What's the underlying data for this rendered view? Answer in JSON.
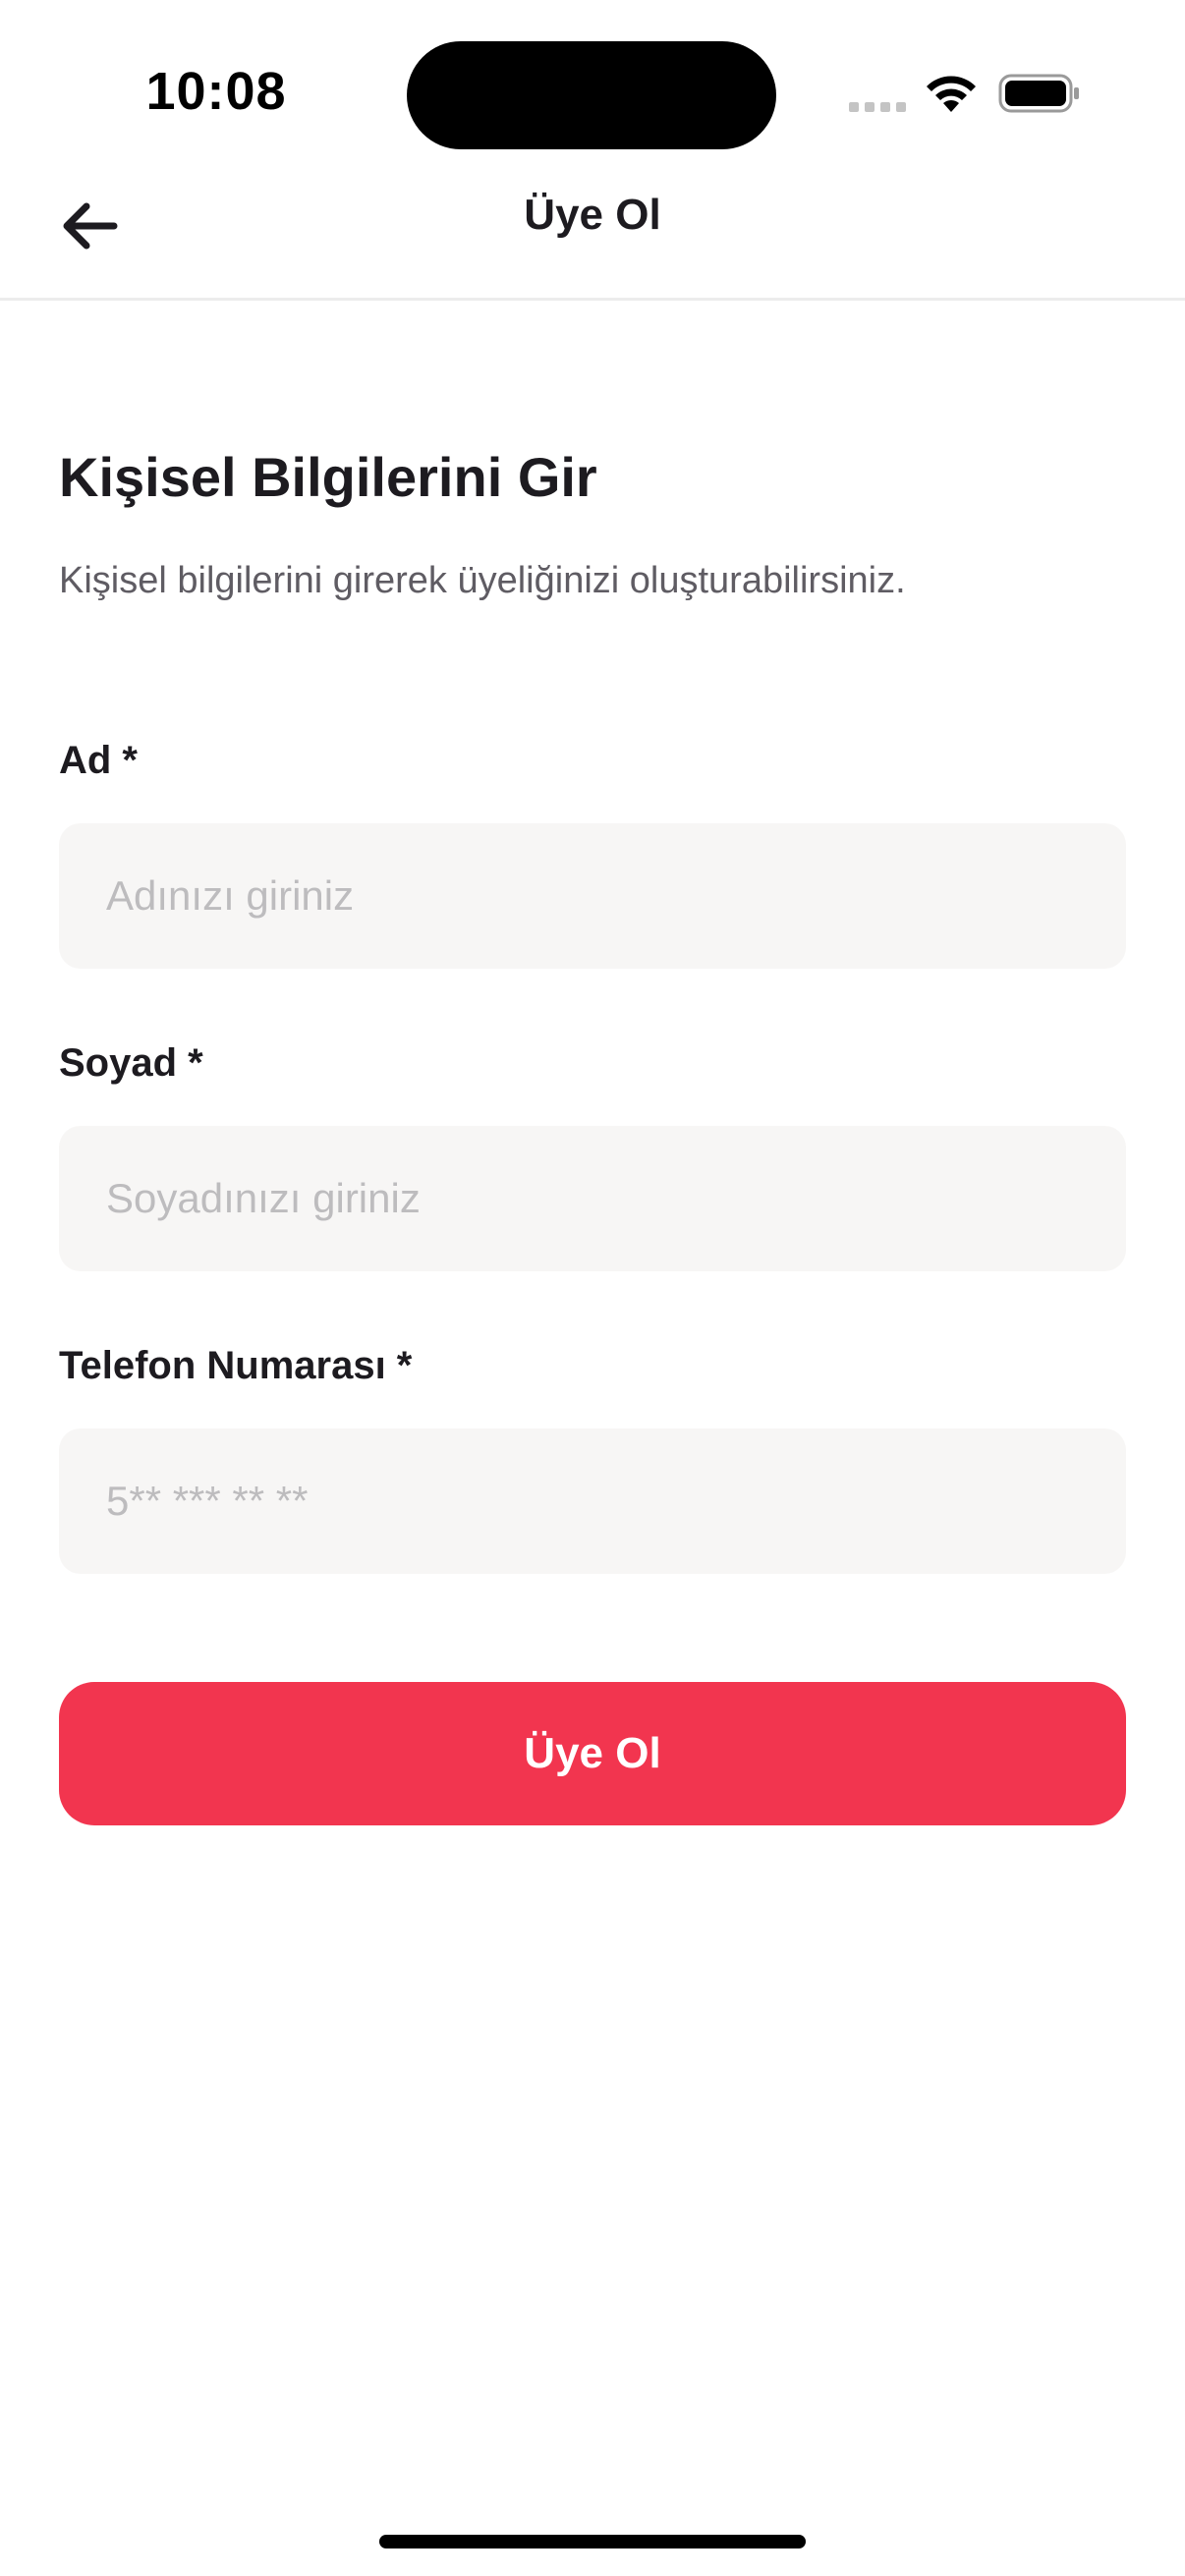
{
  "status_bar": {
    "time": "10:08"
  },
  "header": {
    "title": "Üye Ol",
    "back_icon": "arrow-left-icon"
  },
  "form": {
    "title": "Kişisel Bilgilerini Gir",
    "subtitle": "Kişisel bilgilerini girerek üyeliğinizi oluşturabilirsiniz.",
    "fields": [
      {
        "label": "Ad *",
        "placeholder": "Adınızı giriniz",
        "value": ""
      },
      {
        "label": "Soyad *",
        "placeholder": "Soyadınızı giriniz",
        "value": ""
      },
      {
        "label": "Telefon Numarası *",
        "placeholder": "5** *** ** **",
        "value": ""
      }
    ],
    "submit_label": "Üye Ol"
  },
  "colors": {
    "accent": "#f2354f",
    "input_background": "#f7f6f5",
    "placeholder": "#bdbcbe",
    "text_primary": "#1d1b20",
    "text_secondary": "#5f5c63"
  }
}
